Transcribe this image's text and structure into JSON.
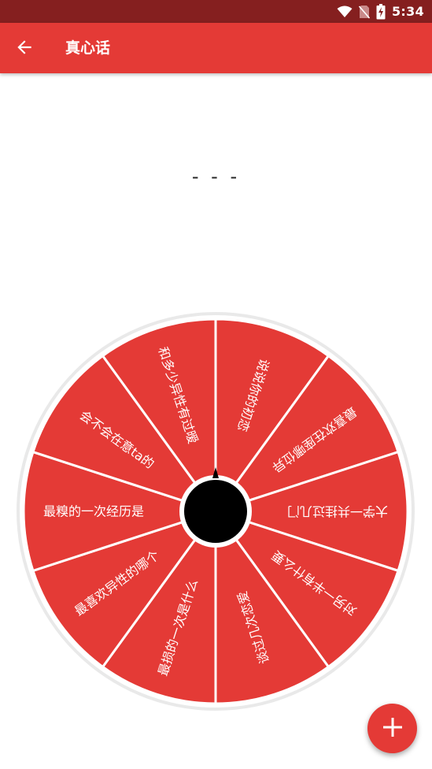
{
  "status_bar": {
    "time": "5:34",
    "icons": [
      "wifi-icon",
      "no-sim-icon",
      "battery-charging-icon"
    ]
  },
  "app_bar": {
    "back_icon": "arrow-left-icon",
    "title": "真心话"
  },
  "result": {
    "text": "- - -"
  },
  "wheel": {
    "segments": [
      "说说你的初恋",
      "最喜欢在座哪位异",
      "大学一共挂过几门",
      "对另一半有什么要",
      "谈过几次恋爱",
      "最损的一次是什么",
      "最喜欢异性的哪个",
      "最糗的一次经历是",
      "会不会在意ta的",
      "和多少异性有过暧"
    ]
  },
  "fab": {
    "icon": "plus-icon"
  },
  "colors": {
    "status_bar": "#851f1f",
    "primary": "#e43a36",
    "wheel_segment": "#e43a36",
    "wheel_rim": "#ffffff",
    "hub": "#000000"
  }
}
